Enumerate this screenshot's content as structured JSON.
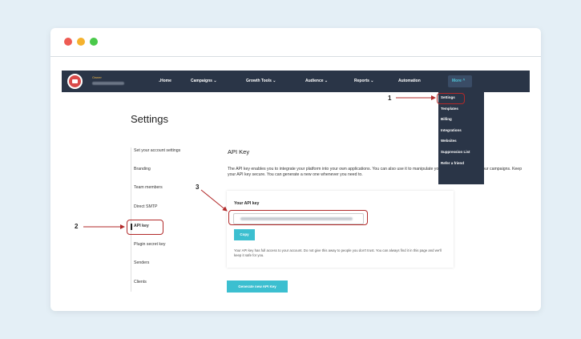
{
  "window": {
    "title_dots": [
      "close",
      "minimize",
      "maximize"
    ]
  },
  "navbar": {
    "owner_role": "Owner",
    "owner_caret": "⌄",
    "items": [
      {
        "label": "Home"
      },
      {
        "label": "Campaigns ⌄"
      },
      {
        "label": "Growth Tools ⌄"
      },
      {
        "label": "Audience ⌄"
      },
      {
        "label": "Reports ⌄"
      },
      {
        "label": "Automation"
      }
    ],
    "more_label": "More ^"
  },
  "dropdown": {
    "items": [
      "Settings",
      "Templates",
      "Billing",
      "Integrations",
      "Websites",
      "Suppression List",
      "Refer a friend"
    ]
  },
  "page": {
    "title": "Settings"
  },
  "sidebar": {
    "items": [
      {
        "label": "Set your account settings"
      },
      {
        "label": "Branding"
      },
      {
        "label": "Team members"
      },
      {
        "label": "Direct SMTP"
      },
      {
        "label": "API key"
      },
      {
        "label": "Plugin secret key"
      },
      {
        "label": "Senders"
      },
      {
        "label": "Clients"
      }
    ]
  },
  "content": {
    "title": "API Key",
    "description": "The API key enables you to integrate your platform into your own applications. You can also use it to manipulate your their members, and your campaigns. Keep your API key secure. You can generate a new one whenever you need to."
  },
  "card": {
    "title": "Your API key",
    "copy_label": "Copy",
    "note": "Your API key has full access to your account. Do not give this away to people you don't trust. You can always find it in this page and we'll keep it safe for you."
  },
  "generate_label": "Generate new API Key",
  "callouts": {
    "one": "1",
    "two": "2",
    "three": "3"
  },
  "colors": {
    "accent": "#3cbfd0",
    "navbar": "#2a3547",
    "annotation": "#b22a2a"
  }
}
